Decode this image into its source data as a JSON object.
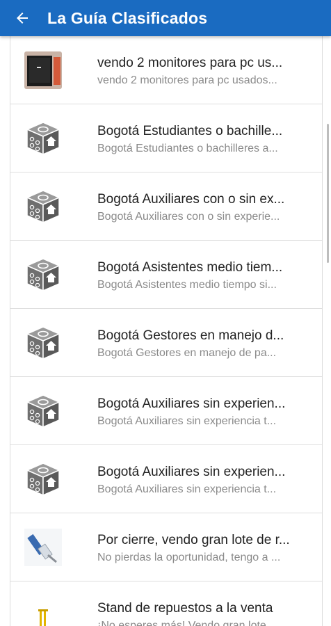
{
  "appbar": {
    "title": "La Guía Clasificados",
    "back_icon": "arrow-left-icon",
    "color": "#1a6bc1"
  },
  "items": [
    {
      "title": "vendo 2 monitores para pc us...",
      "subtitle": "vendo 2 monitores para pc usados...",
      "thumb": "monitor-photo"
    },
    {
      "title": "Bogotá Estudiantes o bachille...",
      "subtitle": "Bogotá Estudiantes o bachilleres a...",
      "thumb": "dice-house-icon"
    },
    {
      "title": "Bogotá Auxiliares con o sin ex...",
      "subtitle": "Bogotá Auxiliares con o sin experie...",
      "thumb": "dice-house-icon"
    },
    {
      "title": "Bogotá Asistentes medio tiem...",
      "subtitle": "Bogotá Asistentes medio tiempo si...",
      "thumb": "dice-house-icon"
    },
    {
      "title": "Bogotá Gestores en manejo d...",
      "subtitle": "Bogotá Gestores en manejo de pa...",
      "thumb": "dice-house-icon"
    },
    {
      "title": "Bogotá Auxiliares sin experien...",
      "subtitle": "Bogotá Auxiliares sin experiencia t...",
      "thumb": "dice-house-icon"
    },
    {
      "title": "Bogotá Auxiliares sin experien...",
      "subtitle": "Bogotá Auxiliares sin experiencia t...",
      "thumb": "dice-house-icon"
    },
    {
      "title": "Por cierre, vendo gran lote de r...",
      "subtitle": "No pierdas la oportunidad, tengo a ...",
      "thumb": "cable-photo"
    },
    {
      "title": "Stand de repuestos a la venta",
      "subtitle": "¡No esperes más! Vendo gran lote ...",
      "thumb": "stand-photo"
    }
  ]
}
